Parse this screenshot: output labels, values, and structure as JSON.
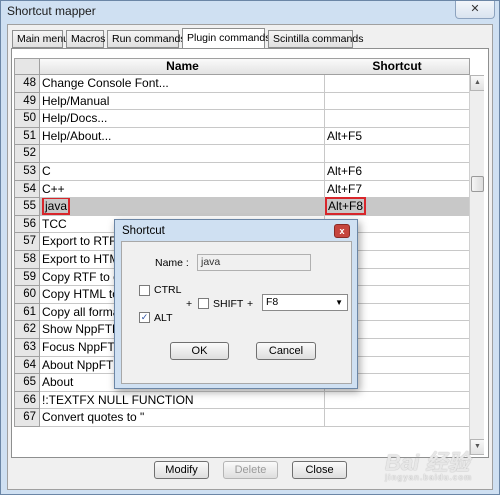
{
  "window": {
    "title": "Shortcut mapper",
    "close_glyph": "✕"
  },
  "tabs": [
    "Main menu",
    "Macros",
    "Run commands",
    "Plugin commands",
    "Scintilla commands"
  ],
  "active_tab": "Plugin commands",
  "grid": {
    "headers": [
      "Name",
      "Shortcut"
    ],
    "rows": [
      {
        "num": "48",
        "name": "Change Console Font...",
        "shortcut": ""
      },
      {
        "num": "49",
        "name": "Help/Manual",
        "shortcut": ""
      },
      {
        "num": "50",
        "name": "Help/Docs...",
        "shortcut": ""
      },
      {
        "num": "51",
        "name": "Help/About...",
        "shortcut": "Alt+F5"
      },
      {
        "num": "52",
        "name": "",
        "shortcut": ""
      },
      {
        "num": "53",
        "name": "C",
        "shortcut": "Alt+F6"
      },
      {
        "num": "54",
        "name": "C++",
        "shortcut": "Alt+F7"
      },
      {
        "num": "55",
        "name": "java",
        "shortcut": "Alt+F8"
      },
      {
        "num": "56",
        "name": "TCC",
        "shortcut": ""
      },
      {
        "num": "57",
        "name": "Export to RTF",
        "shortcut": ""
      },
      {
        "num": "58",
        "name": "Export to HTML",
        "shortcut": ""
      },
      {
        "num": "59",
        "name": "Copy RTF to clip",
        "shortcut": ""
      },
      {
        "num": "60",
        "name": "Copy HTML to c",
        "shortcut": ""
      },
      {
        "num": "61",
        "name": "Copy all formats",
        "shortcut": ""
      },
      {
        "num": "62",
        "name": "Show NppFTP W",
        "shortcut": ""
      },
      {
        "num": "63",
        "name": "Focus NppFTP",
        "shortcut": ""
      },
      {
        "num": "64",
        "name": "About NppFTP",
        "shortcut": ""
      },
      {
        "num": "65",
        "name": "About",
        "shortcut": ""
      },
      {
        "num": "66",
        "name": "!:TEXTFX NULL FUNCTION",
        "shortcut": ""
      },
      {
        "num": "67",
        "name": "Convert quotes to \"",
        "shortcut": ""
      }
    ],
    "selected_row": "55"
  },
  "buttons": {
    "modify": "Modify",
    "delete": "Delete",
    "close": "Close"
  },
  "dialog": {
    "title": "Shortcut",
    "close_glyph": "x",
    "name_label": "Name :",
    "name_value": "java",
    "ctrl_label": "CTRL",
    "alt_label": "ALT",
    "shift_label": "SHIFT",
    "plus": "+",
    "key_value": "F8",
    "ctrl_checked": false,
    "alt_checked": true,
    "shift_checked": false,
    "ok": "OK",
    "cancel": "Cancel"
  },
  "watermark": {
    "text": "Bai 经验",
    "sub": "jingyan.baidu.com"
  },
  "icons": {
    "scroll_up": "up-arrow-icon",
    "scroll_down": "down-arrow-icon",
    "check": "check-icon"
  },
  "colors": {
    "highlight_border": "#d8262b",
    "selected_row": "#c8c8c8"
  }
}
